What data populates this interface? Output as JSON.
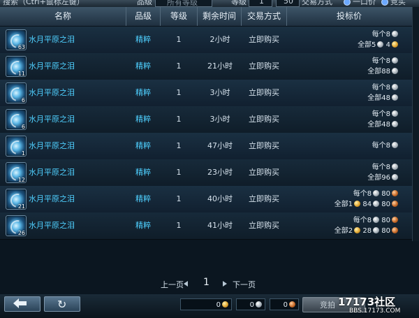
{
  "top": {
    "search_label": "搜索（Ctrl+鼠标左键）",
    "grade_label": "品级",
    "grade_value": "所有等级",
    "level_label": "等级",
    "level_min": "1",
    "level_max": "50",
    "trade_label": "交易方式",
    "opt_all": "全部",
    "opt_buy": "一口价",
    "opt_bid": "竞买"
  },
  "header": {
    "name": "名称",
    "grade": "品级",
    "level": "等级",
    "time": "剩余时间",
    "mode": "交易方式",
    "bid": "投标价"
  },
  "rows": [
    {
      "qty": "63",
      "name": "水月平原之泪",
      "grade": "精粹",
      "level": "1",
      "time": "2小时",
      "mode": "立即购买",
      "l1": "每个8",
      "l2": "全部5",
      "l2b": "4"
    },
    {
      "qty": "11",
      "name": "水月平原之泪",
      "grade": "精粹",
      "level": "1",
      "time": "21小时",
      "mode": "立即购买",
      "l1": "每个8",
      "l2": "全部88"
    },
    {
      "qty": "6",
      "name": "水月平原之泪",
      "grade": "精粹",
      "level": "1",
      "time": "3小时",
      "mode": "立即购买",
      "l1": "每个8",
      "l2": "全部48"
    },
    {
      "qty": "6",
      "name": "水月平原之泪",
      "grade": "精粹",
      "level": "1",
      "time": "3小时",
      "mode": "立即购买",
      "l1": "每个8",
      "l2": "全部48"
    },
    {
      "qty": "1",
      "name": "水月平原之泪",
      "grade": "精粹",
      "level": "1",
      "time": "47小时",
      "mode": "立即购买",
      "l1": "每个8"
    },
    {
      "qty": "12",
      "name": "水月平原之泪",
      "grade": "精粹",
      "level": "1",
      "time": "23小时",
      "mode": "立即购买",
      "l1": "每个8",
      "l2": "全部96"
    },
    {
      "qty": "21",
      "name": "水月平原之泪",
      "grade": "精粹",
      "level": "1",
      "time": "40小时",
      "mode": "立即购买",
      "l1": "每个8",
      "l1b": "80",
      "l2": "全部1",
      "l2b": "84",
      "l2c": "80"
    },
    {
      "qty": "26",
      "name": "水月平原之泪",
      "grade": "精粹",
      "level": "1",
      "time": "41小时",
      "mode": "立即购买",
      "l1": "每个8",
      "l1b": "80",
      "l2": "全部2",
      "l2b": "28",
      "l2c": "80"
    }
  ],
  "pager": {
    "prev": "上一页",
    "page": "1",
    "next": "下一页"
  },
  "bottom": {
    "money_gold": "0",
    "money_silver": "0",
    "money_copper": "0",
    "bid_label": "竞拍"
  },
  "watermark": {
    "logo": "17173社区",
    "url": "BBS.17173.COM"
  }
}
